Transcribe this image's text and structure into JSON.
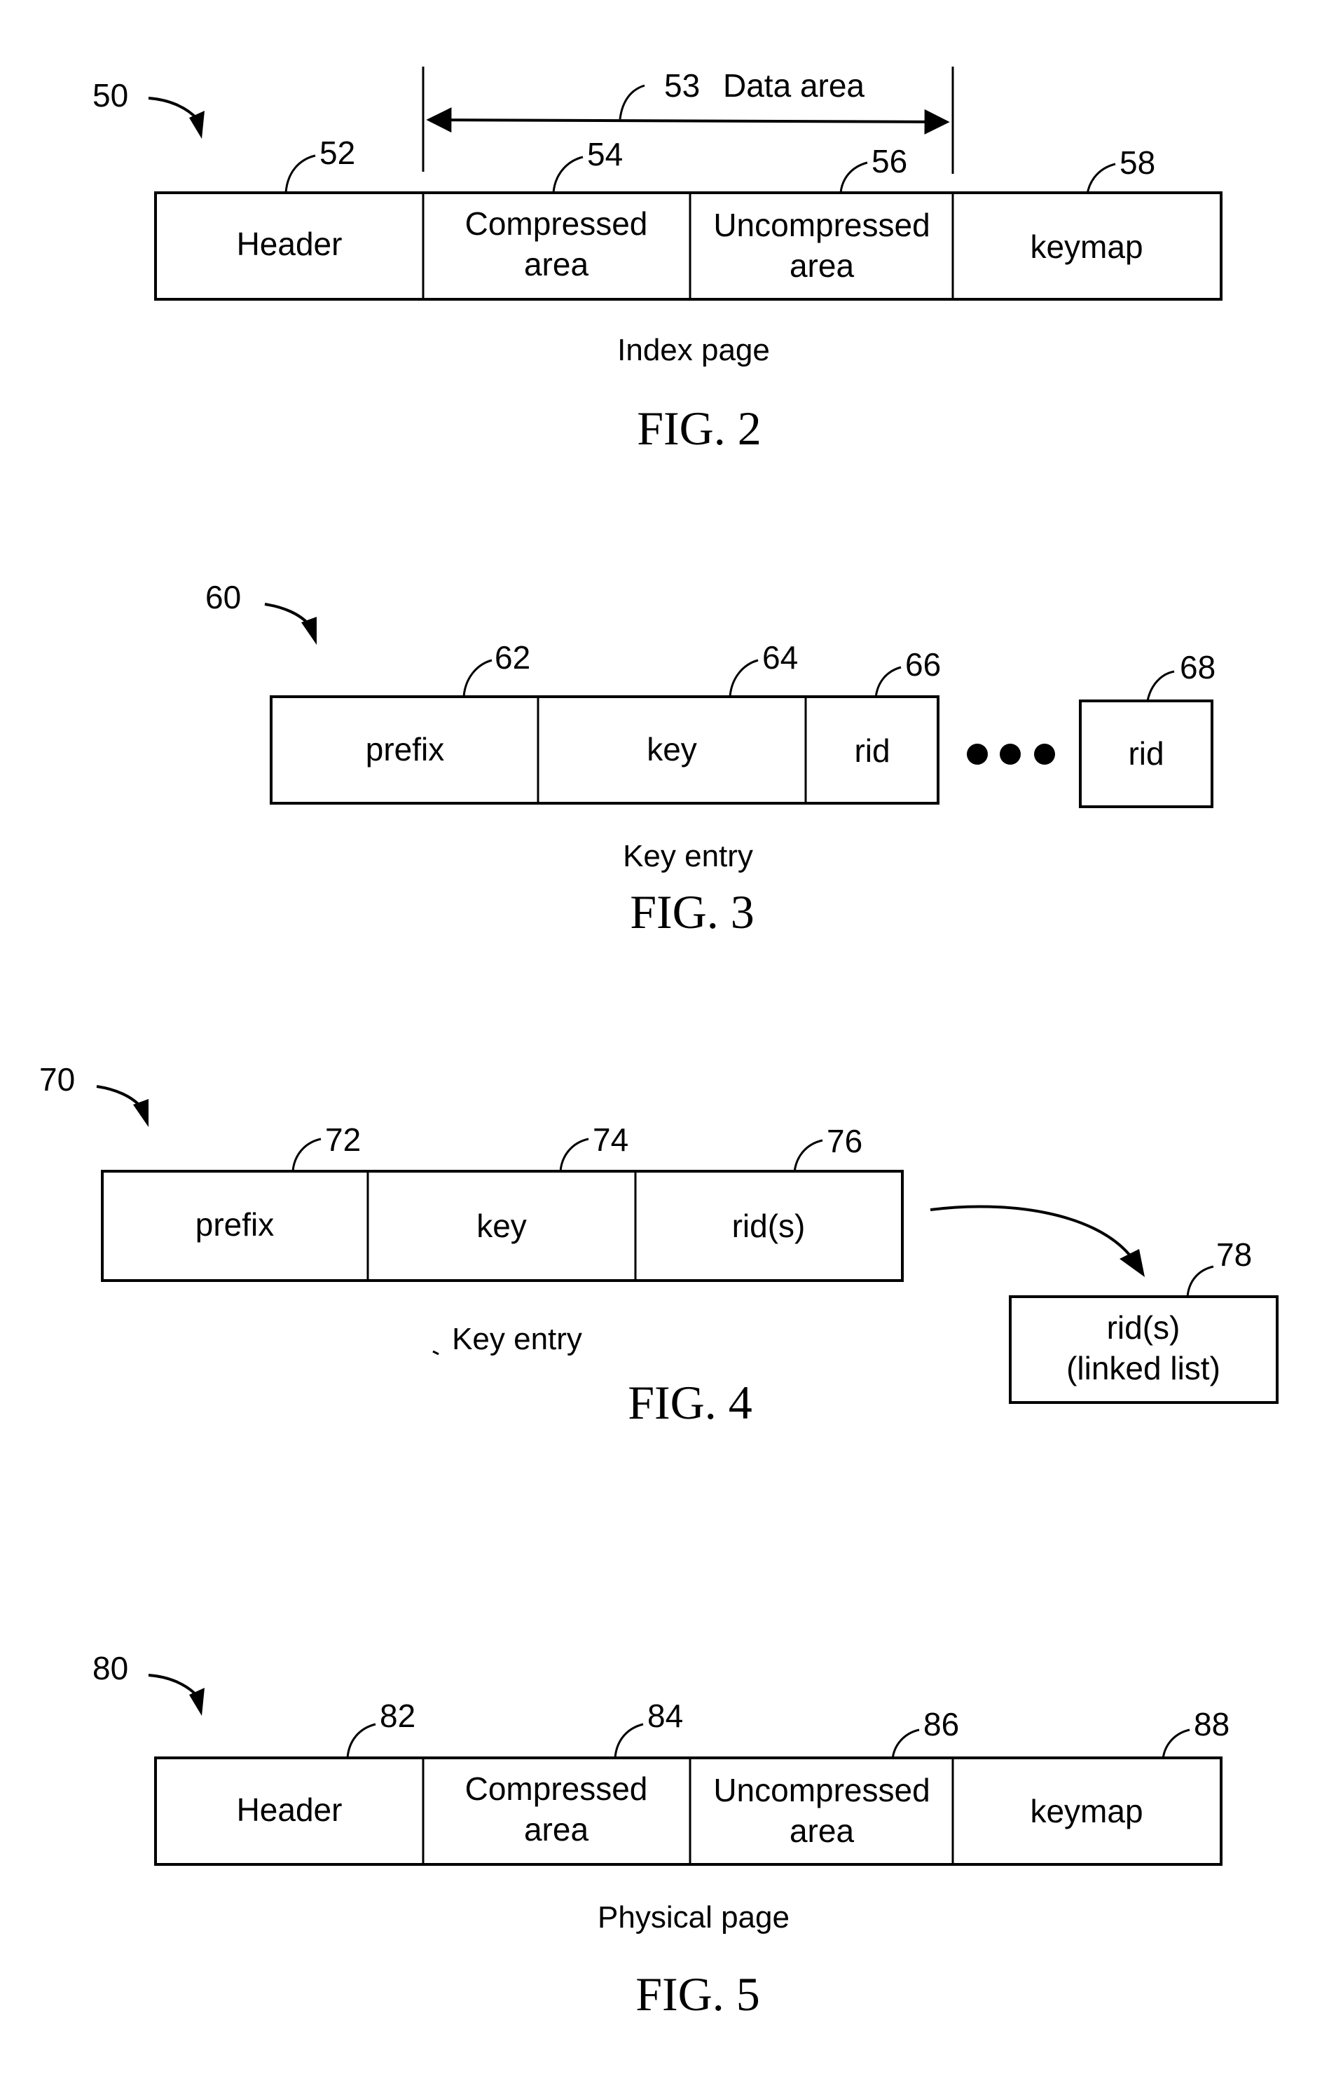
{
  "fig2": {
    "ref": "50",
    "data_area": {
      "ref": "53",
      "label": "Data area"
    },
    "cells": [
      {
        "ref": "52",
        "lines": [
          "Header"
        ]
      },
      {
        "ref": "54",
        "lines": [
          "Compressed",
          "area"
        ]
      },
      {
        "ref": "56",
        "lines": [
          "Uncompressed",
          "area"
        ]
      },
      {
        "ref": "58",
        "lines": [
          "keymap"
        ]
      }
    ],
    "caption": "Index page",
    "title": "FIG. 2"
  },
  "fig3": {
    "ref": "60",
    "cells": [
      {
        "ref": "62",
        "lines": [
          "prefix"
        ]
      },
      {
        "ref": "64",
        "lines": [
          "key"
        ]
      },
      {
        "ref": "66",
        "lines": [
          "rid"
        ]
      }
    ],
    "ellipsis": "●●●",
    "extra_cell": {
      "ref": "68",
      "lines": [
        "rid"
      ]
    },
    "caption": "Key entry",
    "title": "FIG. 3"
  },
  "fig4": {
    "ref": "70",
    "cells": [
      {
        "ref": "72",
        "lines": [
          "prefix"
        ]
      },
      {
        "ref": "74",
        "lines": [
          "key"
        ]
      },
      {
        "ref": "76",
        "lines": [
          "rid(s)"
        ]
      }
    ],
    "linked": {
      "ref": "78",
      "lines": [
        "rid(s)",
        "(linked list)"
      ]
    },
    "caption": "Key entry",
    "title": "FIG. 4"
  },
  "fig5": {
    "ref": "80",
    "cells": [
      {
        "ref": "82",
        "lines": [
          "Header"
        ]
      },
      {
        "ref": "84",
        "lines": [
          "Compressed",
          "area"
        ]
      },
      {
        "ref": "86",
        "lines": [
          "Uncompressed",
          "area"
        ]
      },
      {
        "ref": "88",
        "lines": [
          "keymap"
        ]
      }
    ],
    "caption": "Physical page",
    "title": "FIG. 5"
  }
}
